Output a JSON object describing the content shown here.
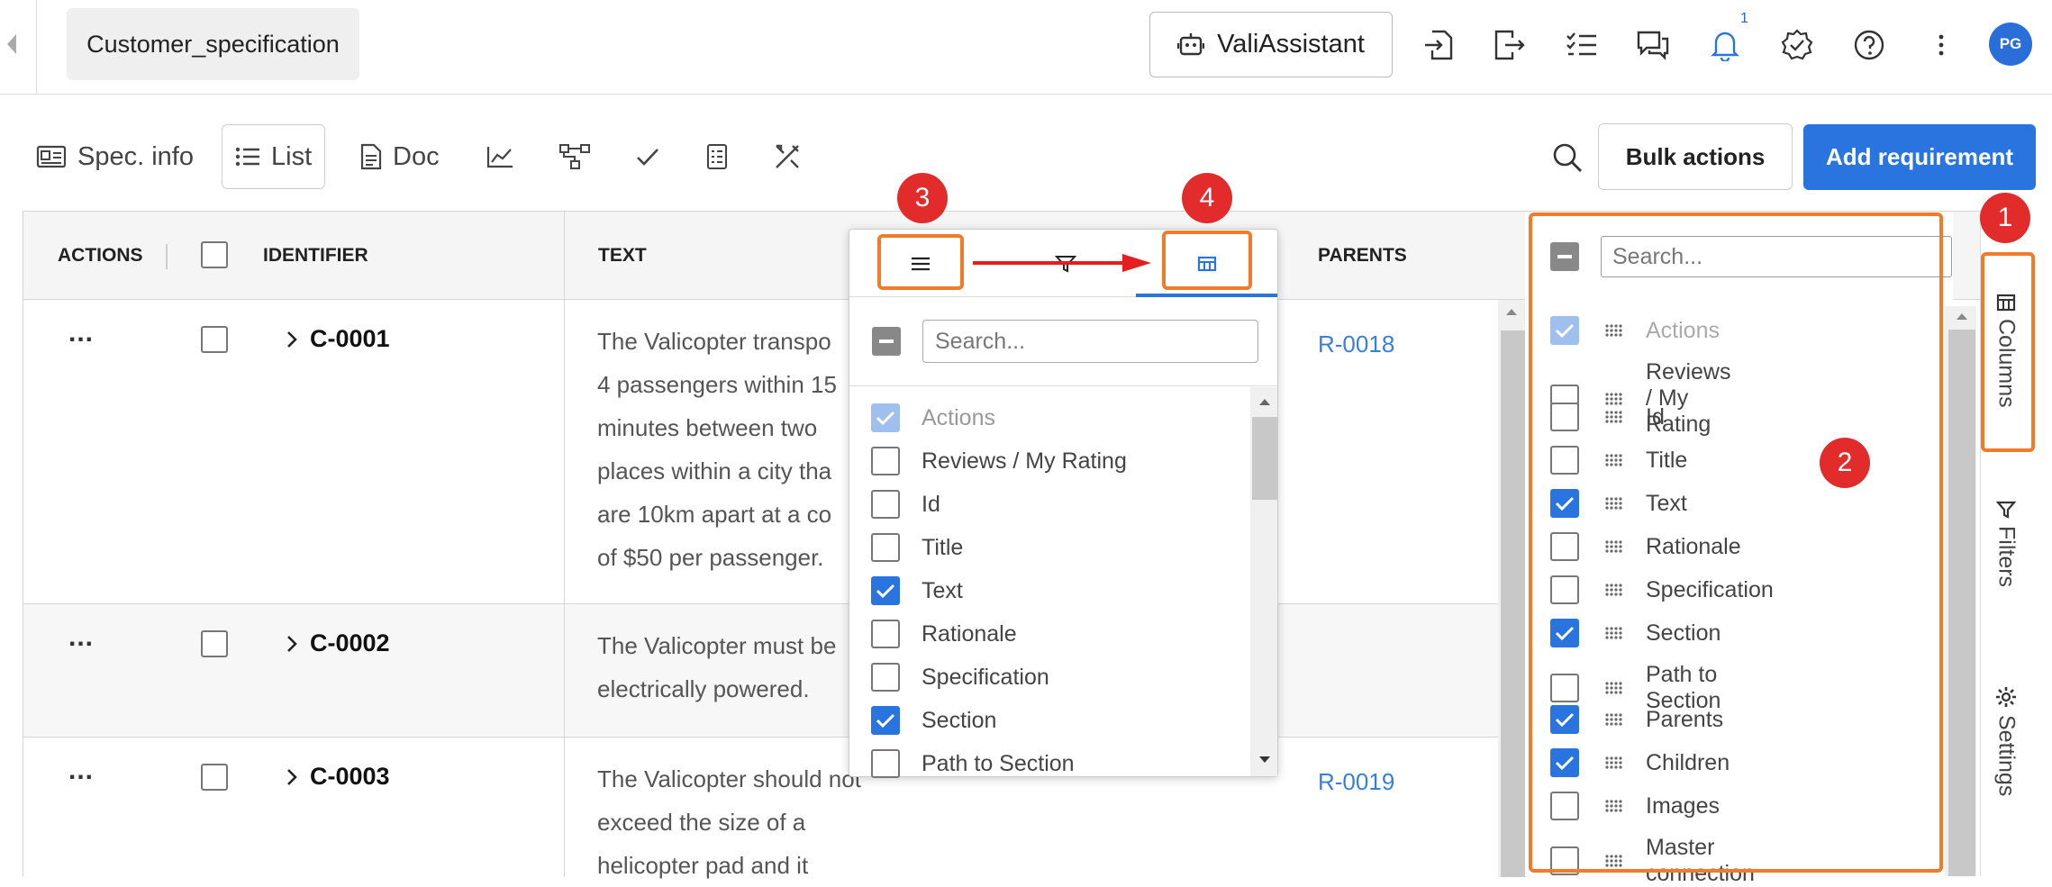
{
  "header": {
    "spec_tab": "Customer_specification",
    "assistant_label": "ValiAssistant",
    "notification_count": "1",
    "avatar_initials": "PG"
  },
  "toolbar": {
    "spec_info": "Spec. info",
    "list": "List",
    "doc": "Doc",
    "bulk_actions": "Bulk actions",
    "add_requirement": "Add requirement"
  },
  "grid": {
    "headers": {
      "actions": "ACTIONS",
      "identifier": "IDENTIFIER",
      "text": "TEXT",
      "parents": "PARENTS"
    },
    "rows": [
      {
        "actions": "...",
        "id": "C-0001",
        "text_lines": [
          "The Valicopter transpo",
          "4 passengers within 15",
          "minutes between two",
          "places within a city tha",
          "are 10km apart at a co",
          "of $50 per passenger."
        ],
        "parent": "R-0018"
      },
      {
        "actions": "...",
        "id": "C-0002",
        "text_lines": [
          "The Valicopter must be",
          "electrically powered."
        ],
        "parent": ""
      },
      {
        "actions": "...",
        "id": "C-0003",
        "text_lines": [
          "The Valicopter should not",
          "exceed the size of a",
          "helicopter pad and it"
        ],
        "parent": "R-0019"
      }
    ]
  },
  "popup": {
    "search_placeholder": "Search...",
    "items": [
      {
        "label": "Actions",
        "checked": true,
        "disabled": true
      },
      {
        "label": "Reviews / My Rating",
        "checked": false
      },
      {
        "label": "Id",
        "checked": false
      },
      {
        "label": "Title",
        "checked": false
      },
      {
        "label": "Text",
        "checked": true
      },
      {
        "label": "Rationale",
        "checked": false
      },
      {
        "label": "Specification",
        "checked": false
      },
      {
        "label": "Section",
        "checked": true
      },
      {
        "label": "Path to Section",
        "checked": false
      }
    ]
  },
  "column_panel": {
    "search_placeholder": "Search...",
    "items": [
      {
        "label": "Actions",
        "checked": true,
        "disabled": true
      },
      {
        "label": "Reviews / My Rating",
        "checked": false
      },
      {
        "label": "Id",
        "checked": false
      },
      {
        "label": "Title",
        "checked": false
      },
      {
        "label": "Text",
        "checked": true
      },
      {
        "label": "Rationale",
        "checked": false
      },
      {
        "label": "Specification",
        "checked": false
      },
      {
        "label": "Section",
        "checked": true
      },
      {
        "label": "Path to Section",
        "checked": false
      },
      {
        "label": "Parents",
        "checked": true
      },
      {
        "label": "Children",
        "checked": true
      },
      {
        "label": "Images",
        "checked": false
      },
      {
        "label": "Master connection",
        "checked": false
      }
    ]
  },
  "side_tabs": {
    "columns": "Columns",
    "filters": "Filters",
    "settings": "Settings"
  },
  "annotations": {
    "badge_1": "1",
    "badge_2": "2",
    "badge_3": "3",
    "badge_4": "4"
  },
  "colors": {
    "accent": "#2a74e0",
    "annotation_box": "#ef7b2b",
    "annotation_badge": "#e22c2c"
  }
}
